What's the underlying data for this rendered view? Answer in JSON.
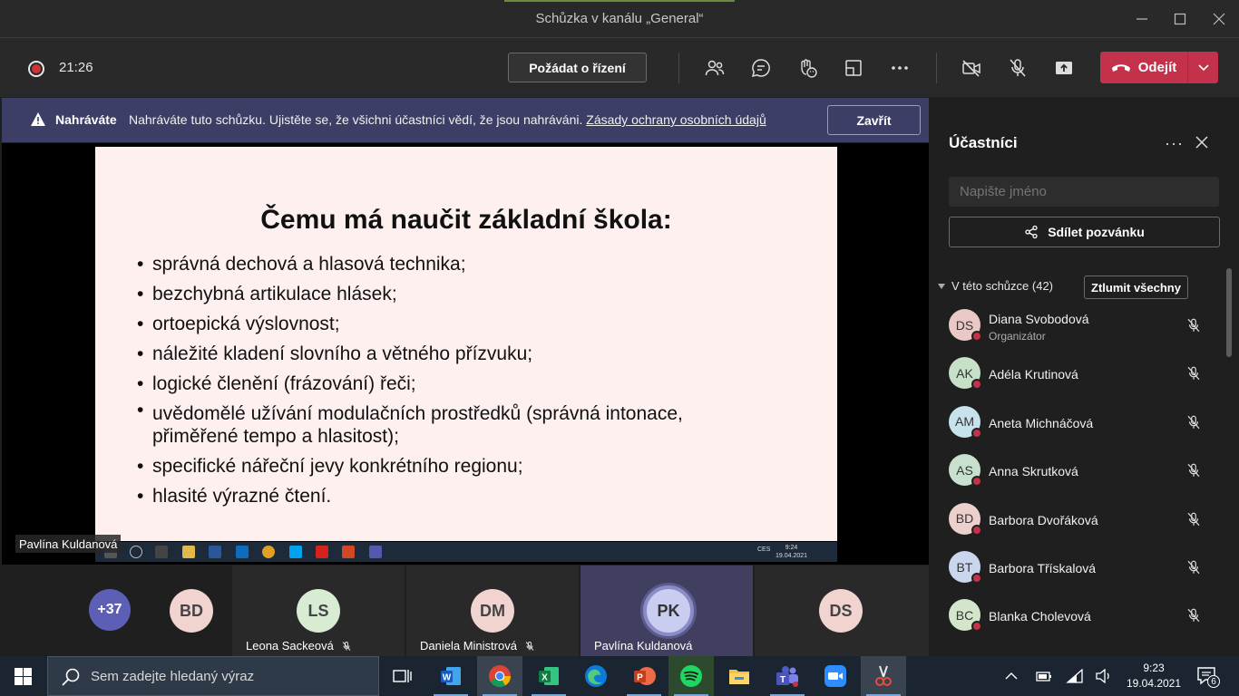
{
  "window": {
    "title": "Schůzka v kanálu „General“"
  },
  "toolbar": {
    "timer": "21:26",
    "request_control": "Požádat o řízení",
    "leave": "Odejít"
  },
  "banner": {
    "title": "Nahráváte",
    "text": "Nahráváte tuto schůzku. Ujistěte se, že všichni účastníci vědí, že jsou nahráváni.",
    "link": "Zásady ochrany osobních údajů",
    "close": "Zavřít"
  },
  "slide": {
    "title": "Čemu má naučit základní škola:",
    "bullets": [
      "správná dechová a hlasová technika;",
      "bezchybná artikulace hlásek;",
      "ortoepická výslovnost;",
      "náležité kladení slovního a větného přízvuku;",
      "logické členění (frázování) řeči;",
      "uvědomělé užívání modulačních prostředků (správná intonace, přiměřené tempo a hlasitost);",
      "specifické nářeční jevy konkrétního regionu;",
      "hlasité výrazné čtení."
    ],
    "mini_time": "9:24",
    "mini_date": "19.04.2021",
    "mini_lang": "CES",
    "presenter": "Pavlína Kuldanová"
  },
  "strip": {
    "overflow": "+37",
    "tiles": [
      {
        "initials": "BD",
        "name": ""
      },
      {
        "initials": "LS",
        "name": "Leona Sackeová"
      },
      {
        "initials": "DM",
        "name": "Daniela Ministrová"
      },
      {
        "initials": "PK",
        "name": "Pavlína Kuldanová"
      },
      {
        "initials": "DS",
        "name": ""
      }
    ]
  },
  "panel": {
    "title": "Účastníci",
    "search_placeholder": "Napište jméno",
    "share": "Sdílet pozvánku",
    "section": "V této schůzce (42)",
    "mute_all": "Ztlumit všechny",
    "participants": [
      {
        "initials": "DS",
        "name": "Diana Svobodová",
        "role": "Organizátor",
        "color": "#e8c9c6"
      },
      {
        "initials": "AK",
        "name": "Adéla Krutinová",
        "role": "",
        "color": "#c7e0c8"
      },
      {
        "initials": "AM",
        "name": "Aneta Michnáčová",
        "role": "",
        "color": "#c6e3ec"
      },
      {
        "initials": "AS",
        "name": "Anna Skrutková",
        "role": "",
        "color": "#c8e1cf"
      },
      {
        "initials": "BD",
        "name": "Barbora Dvořáková",
        "role": "",
        "color": "#ecd0cc"
      },
      {
        "initials": "BT",
        "name": "Barbora Třískalová",
        "role": "",
        "color": "#c9d6ee"
      },
      {
        "initials": "BC",
        "name": "Blanka Cholevová",
        "role": "",
        "color": "#d3e6cc"
      }
    ]
  },
  "taskbar": {
    "search_placeholder": "Sem zadejte hledaný výraz",
    "time": "9:23",
    "date": "19.04.2021",
    "notifications": "6"
  }
}
